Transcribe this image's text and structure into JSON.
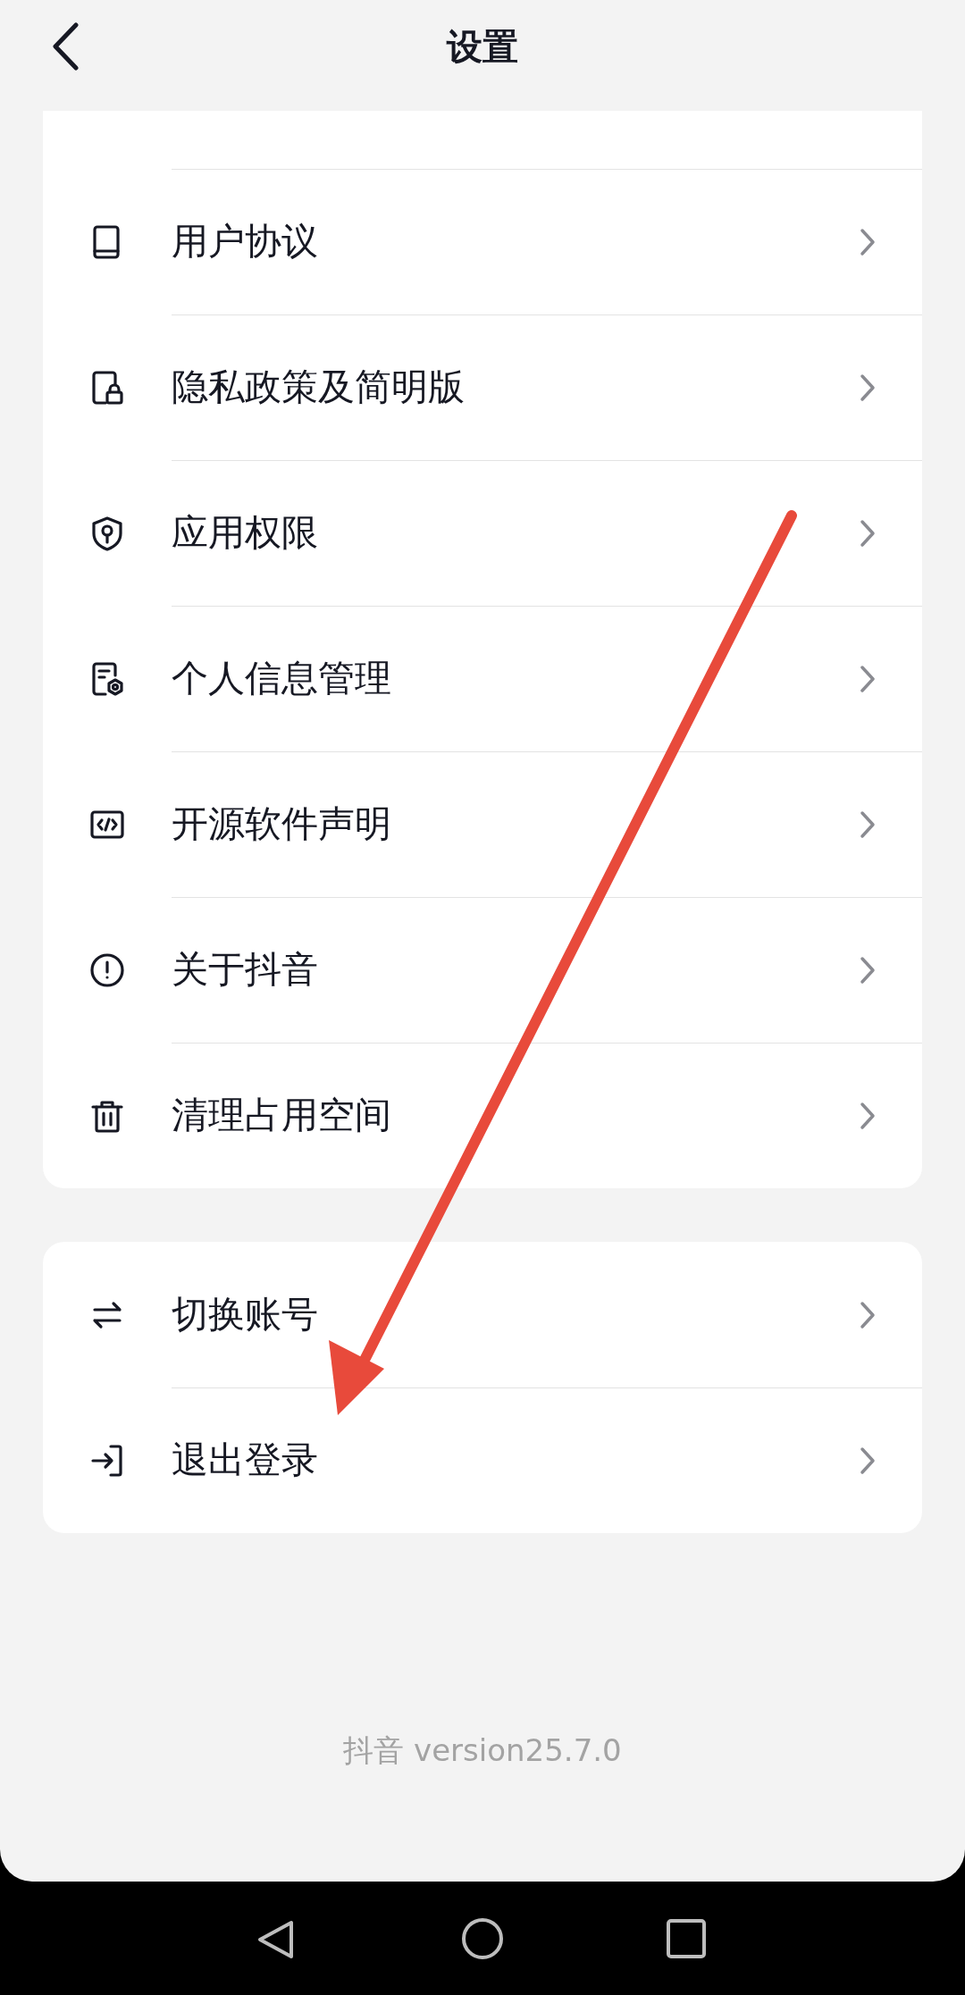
{
  "header": {
    "title": "设置"
  },
  "main_group": {
    "items": [
      {
        "label": "用户协议"
      },
      {
        "label": "隐私政策及简明版"
      },
      {
        "label": "应用权限"
      },
      {
        "label": "个人信息管理"
      },
      {
        "label": "开源软件声明"
      },
      {
        "label": "关于抖音"
      },
      {
        "label": "清理占用空间"
      }
    ]
  },
  "account_group": {
    "items": [
      {
        "label": "切换账号"
      },
      {
        "label": "退出登录"
      }
    ]
  },
  "footer": {
    "version": "抖音 version25.7.0"
  }
}
